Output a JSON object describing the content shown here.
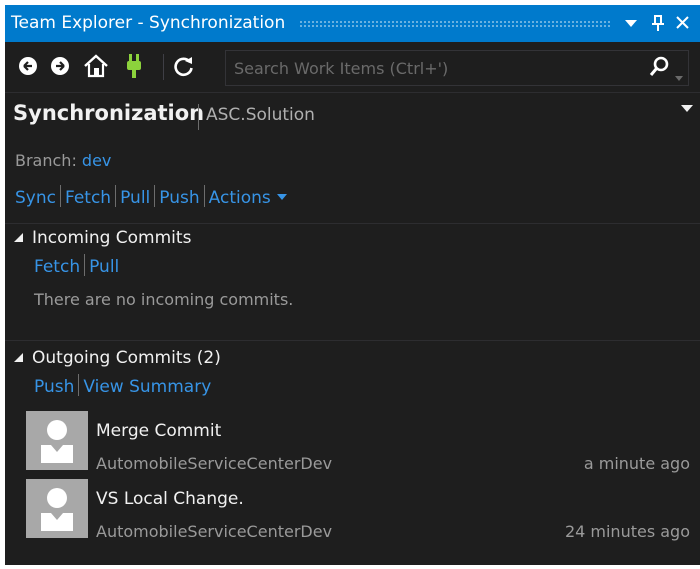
{
  "window": {
    "title": "Team Explorer - Synchronization",
    "pin_icon": "pin-icon",
    "dropdown_icon": "chevron-down-icon",
    "close_icon": "close-icon"
  },
  "toolbar": {
    "search_placeholder": "Search Work Items (Ctrl+')",
    "icons": [
      "back-icon",
      "forward-icon",
      "home-icon",
      "connect-icon",
      "refresh-icon",
      "search-icon"
    ]
  },
  "page": {
    "title": "Synchronization",
    "context": "ASC.Solution"
  },
  "branch": {
    "label": "Branch:",
    "name": "dev"
  },
  "actions": {
    "sync": "Sync",
    "fetch": "Fetch",
    "pull": "Pull",
    "push": "Push",
    "more": "Actions"
  },
  "incoming": {
    "header": "Incoming Commits",
    "fetch": "Fetch",
    "pull": "Pull",
    "empty_message": "There are no incoming commits."
  },
  "outgoing": {
    "header": "Outgoing Commits (2)",
    "push": "Push",
    "view_summary": "View Summary",
    "commits": [
      {
        "title": "Merge Commit",
        "author": "AutomobileServiceCenterDev",
        "time": "a minute ago"
      },
      {
        "title": "VS Local Change.",
        "author": "AutomobileServiceCenterDev",
        "time": "24 minutes ago"
      }
    ]
  },
  "colors": {
    "title_bar": "#007acc",
    "background": "#1e1e1e",
    "link": "#3794e6",
    "text": "#f1f1f1",
    "muted_text": "#9a9a9a",
    "connect_icon": "#8cd23c"
  }
}
